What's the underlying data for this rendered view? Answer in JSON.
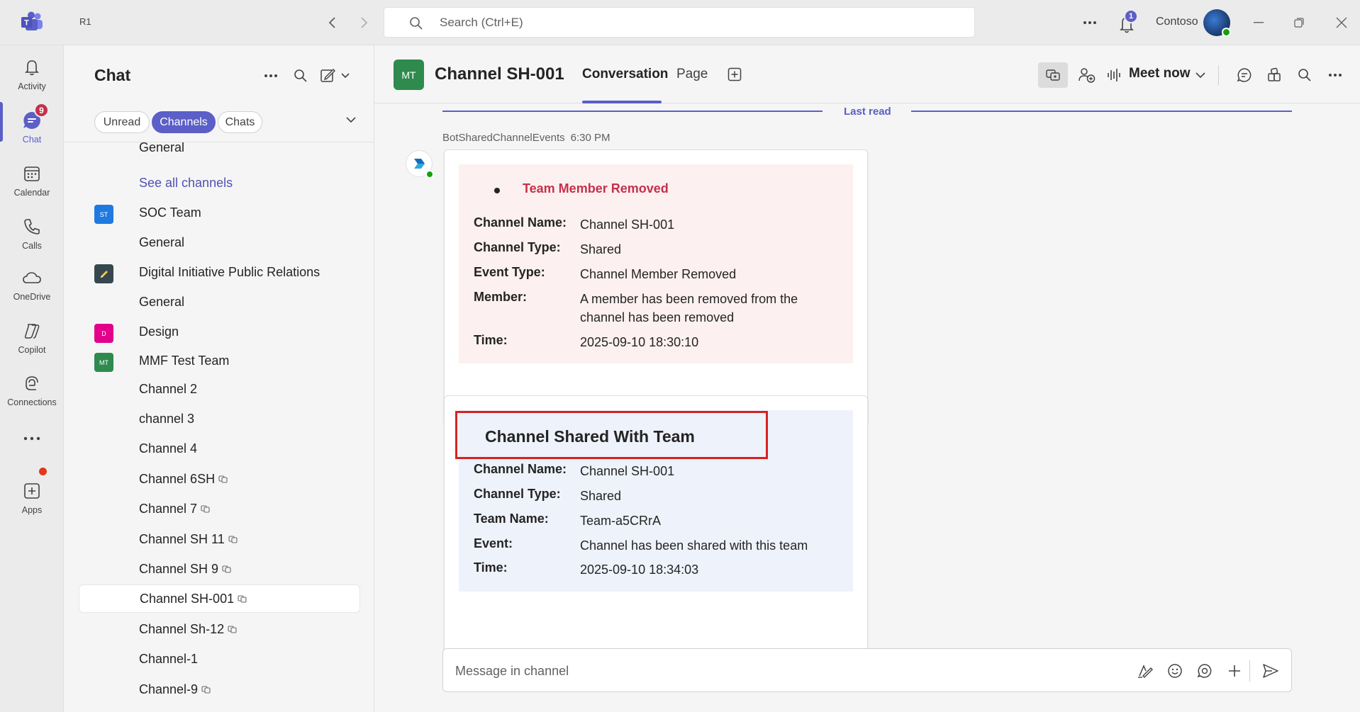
{
  "titlebar": {
    "tenant_short": "R1",
    "search_placeholder": "Search (Ctrl+E)",
    "notification_count": "1",
    "org_name": "Contoso"
  },
  "rail": {
    "items": [
      {
        "label": "Activity",
        "icon": "bell-icon"
      },
      {
        "label": "Chat",
        "icon": "chat-icon",
        "badge": "9"
      },
      {
        "label": "Calendar",
        "icon": "calendar-icon"
      },
      {
        "label": "Calls",
        "icon": "phone-icon"
      },
      {
        "label": "OneDrive",
        "icon": "cloud-icon"
      },
      {
        "label": "Copilot",
        "icon": "copilot-icon"
      },
      {
        "label": "Connections",
        "icon": "connections-icon"
      },
      {
        "label": "Apps",
        "icon": "plus-square-icon"
      }
    ]
  },
  "sidebar": {
    "title": "Chat",
    "filters": [
      "Unread",
      "Channels",
      "Chats"
    ],
    "rows": [
      {
        "type": "channel",
        "label": "General"
      },
      {
        "type": "link",
        "label": "See all channels"
      },
      {
        "type": "team",
        "label": "SOC Team",
        "avatar": "ST",
        "color": "#1f7ae0"
      },
      {
        "type": "channel",
        "label": "General"
      },
      {
        "type": "team",
        "label": "Digital Initiative Public Relations",
        "avatar": "",
        "color": "#37474f"
      },
      {
        "type": "channel",
        "label": "General"
      },
      {
        "type": "team",
        "label": "Design",
        "avatar": "D",
        "color": "#e3008c"
      },
      {
        "type": "team",
        "label": "MMF Test Team",
        "avatar": "MT",
        "color": "#2f8a4e"
      },
      {
        "type": "channel",
        "label": "Channel 2"
      },
      {
        "type": "channel",
        "label": "channel 3"
      },
      {
        "type": "channel",
        "label": "Channel 4"
      },
      {
        "type": "channel",
        "label": "Channel 6SH",
        "shared": true
      },
      {
        "type": "channel",
        "label": "Channel 7",
        "shared": true
      },
      {
        "type": "channel",
        "label": "Channel SH 11",
        "shared": true
      },
      {
        "type": "channel",
        "label": "Channel SH 9",
        "shared": true
      },
      {
        "type": "channel",
        "label": "Channel SH-001",
        "shared": true,
        "selected": true
      },
      {
        "type": "channel",
        "label": "Channel Sh-12",
        "shared": true
      },
      {
        "type": "channel",
        "label": "Channel-1"
      },
      {
        "type": "channel",
        "label": "Channel-9",
        "shared": true
      }
    ]
  },
  "channel": {
    "avatar": "MT",
    "name": "Channel SH-001",
    "tabs": [
      "Conversation",
      "Page"
    ],
    "meet_now": "Meet now"
  },
  "conversation": {
    "last_read": "Last read",
    "sender": "BotSharedChannelEvents",
    "time": "6:30 PM",
    "card1": {
      "title": "Team Member Removed",
      "fields": [
        {
          "k": "Channel Name:",
          "v": "Channel SH-001"
        },
        {
          "k": "Channel Type:",
          "v": "Shared"
        },
        {
          "k": "Event Type:",
          "v": "Channel Member Removed"
        },
        {
          "k": "Member:",
          "v": "A member has been removed from the channel has been removed"
        },
        {
          "k": "Time:",
          "v": "2025-09-10 18:30:10"
        }
      ]
    },
    "card2": {
      "title": "Channel Shared With Team",
      "fields": [
        {
          "k": "Channel Name:",
          "v": "Channel SH-001"
        },
        {
          "k": "Channel Type:",
          "v": "Shared"
        },
        {
          "k": "Team Name:",
          "v": "Team-a5CRrA"
        },
        {
          "k": "Event:",
          "v": "Channel has been shared with this team"
        },
        {
          "k": "Time:",
          "v": "2025-09-10 18:34:03"
        }
      ]
    }
  },
  "composer": {
    "placeholder": "Message in channel"
  },
  "colors": {
    "accent": "#5b5fc7",
    "removed_title": "#c4314b",
    "highlight_box": "#d92121"
  }
}
